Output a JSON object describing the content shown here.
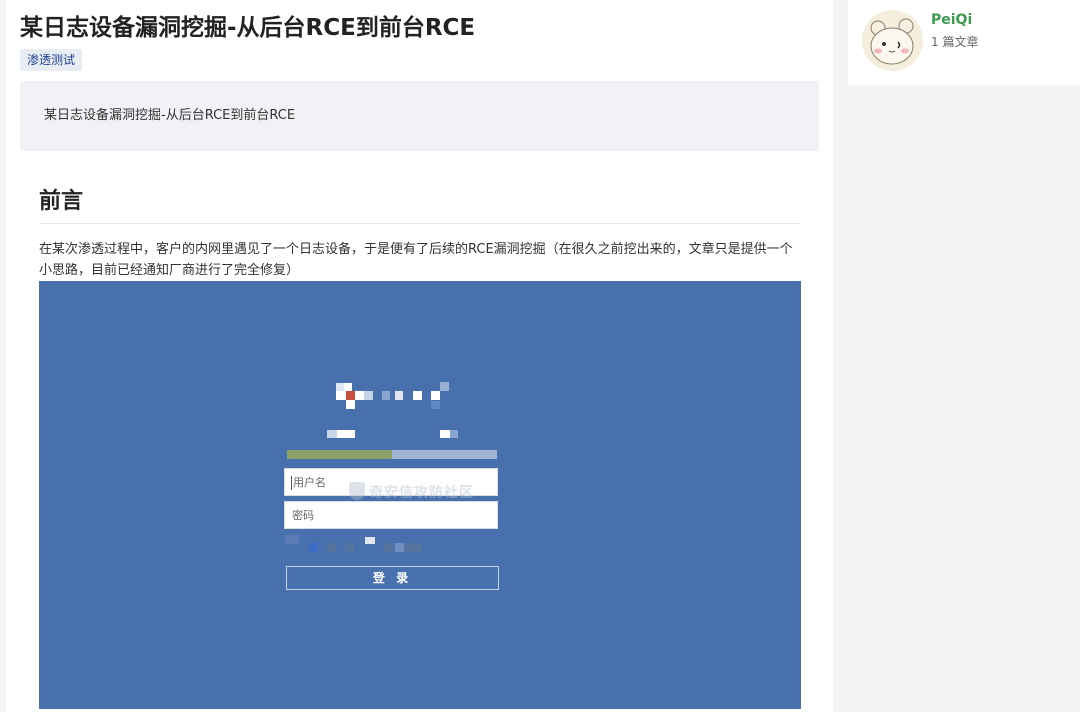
{
  "article": {
    "title": "某日志设备漏洞挖掘-从后台RCE到前台RCE",
    "tag": "渗透测试",
    "summary": "某日志设备漏洞挖掘-从后台RCE到前台RCE",
    "section_heading": "前言",
    "paragraph": "在某次渗透过程中，客户的内网里遇见了一个日志设备，于是便有了后续的RCE漏洞挖掘（在很久之前挖出来的，文章只是提供一个小思路，目前已经通知厂商进行了完全修复）"
  },
  "login_screenshot": {
    "username_placeholder": "用户名",
    "password_placeholder": "密码",
    "login_label": "登 录",
    "watermark": "奇安信攻防社区",
    "progress_fraction": 0.5,
    "background_color": "#4870ad"
  },
  "author": {
    "name": "PeiQi",
    "article_count": "1 篇文章",
    "name_color": "#3e9b4f"
  }
}
